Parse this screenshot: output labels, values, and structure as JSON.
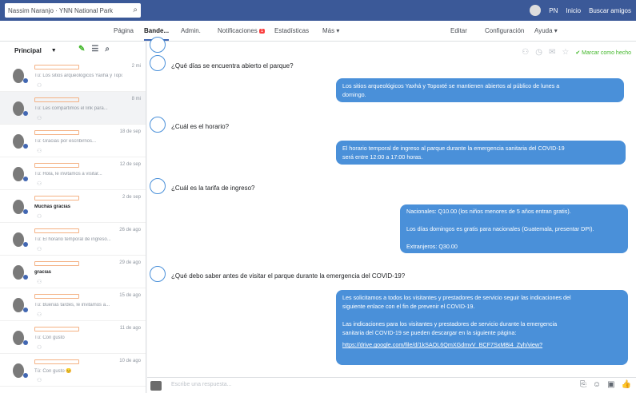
{
  "topbar": {
    "search_text": "Nassim Naranjo · YNN National Park",
    "user": "PN",
    "links": [
      "Inicio",
      "Buscar amigos"
    ]
  },
  "tabs": [
    {
      "label": "Página",
      "active": false
    },
    {
      "label": "Bande...",
      "active": true
    },
    {
      "label": "Admin.",
      "active": false
    },
    {
      "label": "Notificaciones",
      "active": false,
      "badge": "1"
    },
    {
      "label": "Estadísticas",
      "active": false
    },
    {
      "label": "Más ▾",
      "active": false
    }
  ],
  "tabs_right": [
    "Editar",
    "Configuración",
    "Ayuda ▾"
  ],
  "left": {
    "filter_label": "Principal",
    "conversations": [
      {
        "snippet": "Tú: Los sitios arqueológicos Yaxhá y Topoxté...",
        "date": "2 mi",
        "bold": false,
        "selected": false
      },
      {
        "snippet": "Tú: Les compartimos el link para...",
        "date": "8 mi",
        "bold": false,
        "selected": true
      },
      {
        "snippet": "Tú: Gracias por escribirnos...",
        "date": "18 de sep",
        "bold": false,
        "selected": false
      },
      {
        "snippet": "Tú: Hola, le invitamos a visitar...",
        "date": "12 de sep",
        "bold": false,
        "selected": false
      },
      {
        "snippet": "Muchas gracias",
        "date": "2 de sep",
        "bold": true,
        "selected": false
      },
      {
        "snippet": "Tú: El horario temporal de ingreso...",
        "date": "26 de ago",
        "bold": false,
        "selected": false
      },
      {
        "snippet": "gracias",
        "date": "29 de ago",
        "bold": true,
        "selected": false
      },
      {
        "snippet": "Tú: Buenas tardes, le invitamos a...",
        "date": "15 de ago",
        "bold": false,
        "selected": false
      },
      {
        "snippet": "Tú: Con gusto",
        "date": "11 de ago",
        "bold": false,
        "selected": false
      },
      {
        "snippet": "Tú: Con gusto 😊",
        "date": "10 de ago",
        "bold": false,
        "selected": false
      }
    ]
  },
  "chat": {
    "done_label": "Marcar como hecho",
    "questions": [
      "¿Qué días se encuentra abierto el parque?",
      "¿Cuál es el horario?",
      "¿Cuál es la tarifa de ingreso?",
      "¿Qué debo saber antes de visitar el parque durante la emergencia del COVID-19?"
    ],
    "answers": {
      "a1": [
        "Los sitios arqueológicos Yaxhá y Topoxté se mantienen abiertos al público de lunes a",
        "domingo."
      ],
      "a2": [
        "El horario temporal de ingreso al parque durante la emergencia sanitaria del COVID-19",
        "será entre 12:00 a 17:00 horas."
      ],
      "a3": [
        "Nacionales: Q10.00 (los niños menores de 5 años entran gratis).",
        "Los días domingos es gratis para nacionales (Guatemala, presentar DPI).",
        "Extranjeros: Q30.00"
      ],
      "a4": [
        "Les solicitamos a todos los visitantes y prestadores de servicio seguir las indicaciones del",
        "siguiente enlace con el fin de prevenir el COVID-19.",
        "Las indicaciones para los visitantes y prestadores de servicio durante la emergencia",
        "sanitaria del COVID-19 se pueden descargar en la siguiente página:",
        "https://drive.google.com/file/d/1kSAOL6QmXGdmvV_BCF7SxMBi4_Zyh/view?"
      ]
    }
  },
  "composer": {
    "placeholder": "Escribe una respuesta..."
  }
}
